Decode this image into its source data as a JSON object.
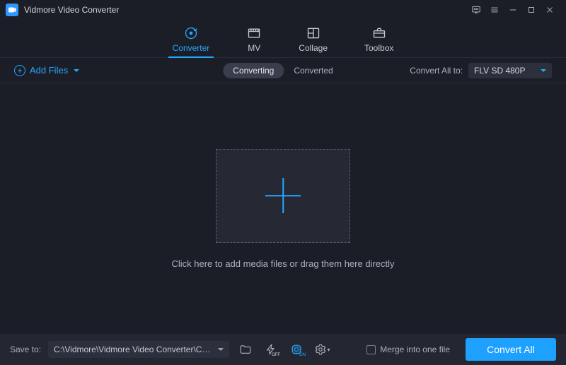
{
  "app": {
    "title": "Vidmore Video Converter"
  },
  "tabs": {
    "converter": "Converter",
    "mv": "MV",
    "collage": "Collage",
    "toolbox": "Toolbox"
  },
  "actionbar": {
    "add_files": "Add Files",
    "converting": "Converting",
    "converted": "Converted",
    "convert_all_to_label": "Convert All to:",
    "format_selected": "FLV SD 480P"
  },
  "workspace": {
    "hint": "Click here to add media files or drag them here directly"
  },
  "footer": {
    "save_to_label": "Save to:",
    "save_path": "C:\\Vidmore\\Vidmore Video Converter\\Converted",
    "hw_badge": "OFF",
    "gpu_badge": "ON",
    "merge_label": "Merge into one file",
    "convert_all": "Convert All"
  }
}
